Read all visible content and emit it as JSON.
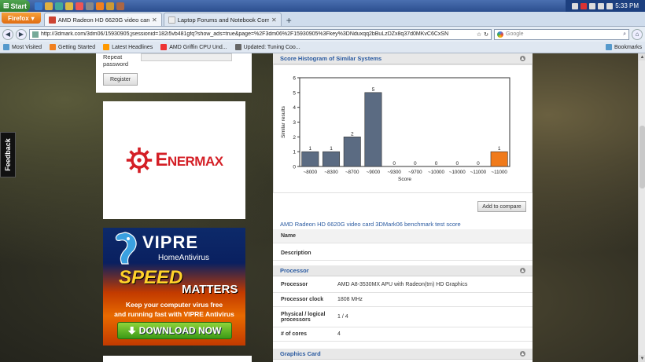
{
  "taskbar": {
    "start": "Start",
    "clock": "5:33 PM"
  },
  "browser": {
    "app_button": "Firefox",
    "tabs": [
      {
        "title": "AMD Radeon HD 6620G video card bench..."
      },
      {
        "title": "Laptop Forums and Notebook Computer ..."
      }
    ],
    "new_tab": "+",
    "url": "http://3dmark.com/3dm06/15930905;jsessionid=182i5vb481gfq?show_ads=true&page=%2F3dm06%2F15930905%3Fkey%3DNduxqq2bBuLzDZx8q37d0MKvC6CxSN",
    "search_placeholder": "Google",
    "bookmarks": [
      "Most Visited",
      "Getting Started",
      "Latest Headlines",
      "AMD Griffin CPU Und...",
      "Updated: Tuning Coo..."
    ],
    "bookmarks_right": "Bookmarks"
  },
  "sidebar": {
    "repeat_password": "Repeat password",
    "register": "Register",
    "ad1_brand": "Enermax",
    "ad2": {
      "brand": "VIPRE",
      "sub": "HomeAntivirus",
      "speed": "SPEED",
      "matters": "MATTERS",
      "line1": "Keep your computer virus free",
      "line2": "and running fast with VIPRE Antivirus",
      "cta": "DOWNLOAD NOW"
    }
  },
  "feedback": "Feedback",
  "histogram_header": "Score Histogram of Similar Systems",
  "add_to_compare": "Add to compare",
  "page_title": "AMD Radeon HD 6620G video card 3DMark06 benchmark test score",
  "rows": {
    "name": "Name",
    "description": "Description"
  },
  "processor": {
    "header": "Processor",
    "fields": [
      {
        "k": "Processor",
        "v": "AMD A8-3530MX APU with Radeon(tm) HD Graphics"
      },
      {
        "k": "Processor clock",
        "v": "1808 MHz"
      },
      {
        "k": "Physical / logical processors",
        "v": "1 / 4"
      },
      {
        "k": "# of cores",
        "v": "4"
      }
    ]
  },
  "graphics_header": "Graphics Card",
  "chart_data": {
    "type": "bar",
    "categories": [
      "~8000",
      "~8300",
      "~8700",
      "~9000",
      "~9300",
      "~9700",
      "~10000",
      "~10000",
      "~11000",
      "~11000"
    ],
    "values": [
      1,
      1,
      2,
      5,
      0,
      0,
      0,
      0,
      0,
      1
    ],
    "highlight_index": 9,
    "xlabel": "Score",
    "ylabel": "Similar results",
    "ylim": [
      0,
      6
    ],
    "yticks": [
      0,
      1,
      2,
      3,
      4,
      5,
      6
    ],
    "colors": {
      "bar": "#5b6b82",
      "highlight": "#f07a1a"
    },
    "grid": false
  }
}
